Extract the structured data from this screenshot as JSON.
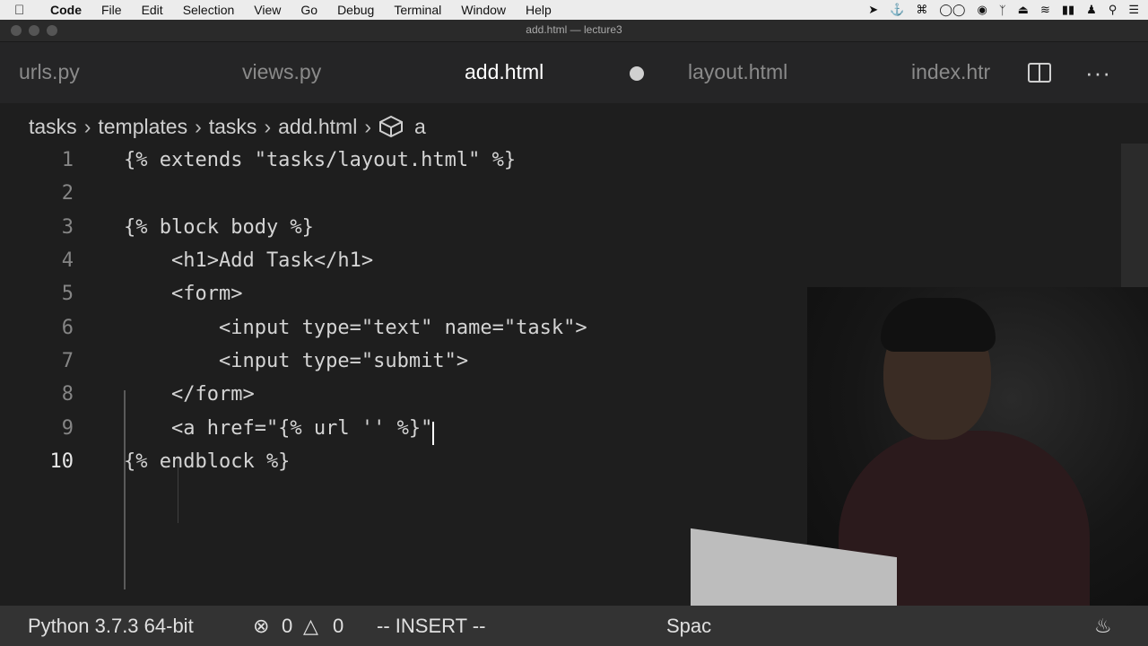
{
  "menubar": {
    "app": "Code",
    "items": [
      "File",
      "Edit",
      "Selection",
      "View",
      "Go",
      "Debug",
      "Terminal",
      "Window",
      "Help"
    ]
  },
  "window": {
    "title": "add.html — lecture3"
  },
  "tabs": [
    {
      "label": "urls.py",
      "active": false
    },
    {
      "label": "views.py",
      "active": false
    },
    {
      "label": "add.html",
      "active": true,
      "modified": true
    },
    {
      "label": "layout.html",
      "active": false
    },
    {
      "label": "index.htr",
      "active": false
    }
  ],
  "breadcrumb": [
    "tasks",
    "templates",
    "tasks",
    "add.html",
    "a"
  ],
  "editor": {
    "lines": [
      {
        "n": "1",
        "text": "{% extends \"tasks/layout.html\" %}"
      },
      {
        "n": "2",
        "text": ""
      },
      {
        "n": "3",
        "text": "{% block body %}"
      },
      {
        "n": "4",
        "text": "    <h1>Add Task</h1>"
      },
      {
        "n": "5",
        "text": "    <form>"
      },
      {
        "n": "6",
        "text": "        <input type=\"text\" name=\"task\">"
      },
      {
        "n": "7",
        "text": "        <input type=\"submit\">"
      },
      {
        "n": "8",
        "text": "    </form>"
      },
      {
        "n": "9",
        "text": "    <a href=\"{% url '' %}\""
      },
      {
        "n": "10",
        "text": "{% endblock %}"
      }
    ],
    "current_line": "10"
  },
  "statusbar": {
    "interpreter": "Python 3.7.3 64-bit",
    "errors": "0",
    "warnings": "0",
    "mode": "-- INSERT --",
    "indent": "Spac"
  },
  "colors": {
    "editor_bg": "#1e1e1e",
    "string": "#ce9178",
    "statusbar_bg": "#333333"
  }
}
